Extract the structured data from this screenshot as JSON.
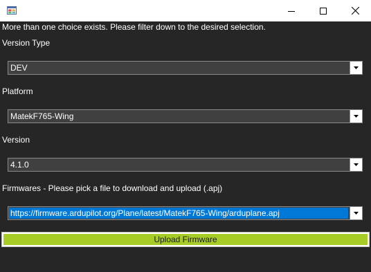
{
  "window": {
    "title": ""
  },
  "header": {
    "message": "More than one choice exists. Please filter down to the desired selection."
  },
  "version_type": {
    "label": "Version Type",
    "selected": "DEV"
  },
  "platform": {
    "label": "Platform",
    "selected": "MatekF765-Wing"
  },
  "version": {
    "label": "Version",
    "selected": "4.1.0"
  },
  "firmwares": {
    "label": "Firmwares - Please pick a file to download and upload (.apj)",
    "selected": "https://firmware.ardupilot.org/Plane/latest/MatekF765-Wing/arduplane.apj"
  },
  "upload_button": {
    "label": "Upload Firmware"
  },
  "colors": {
    "background": "#262626",
    "combo_background": "#404040",
    "selection_highlight": "#0078d7",
    "upload_button": "#a7cc26"
  },
  "icons": {
    "app": "app-window-icon",
    "minimize": "minimize-icon",
    "maximize": "maximize-icon",
    "close": "close-icon",
    "dropdown": "chevron-down-icon"
  }
}
